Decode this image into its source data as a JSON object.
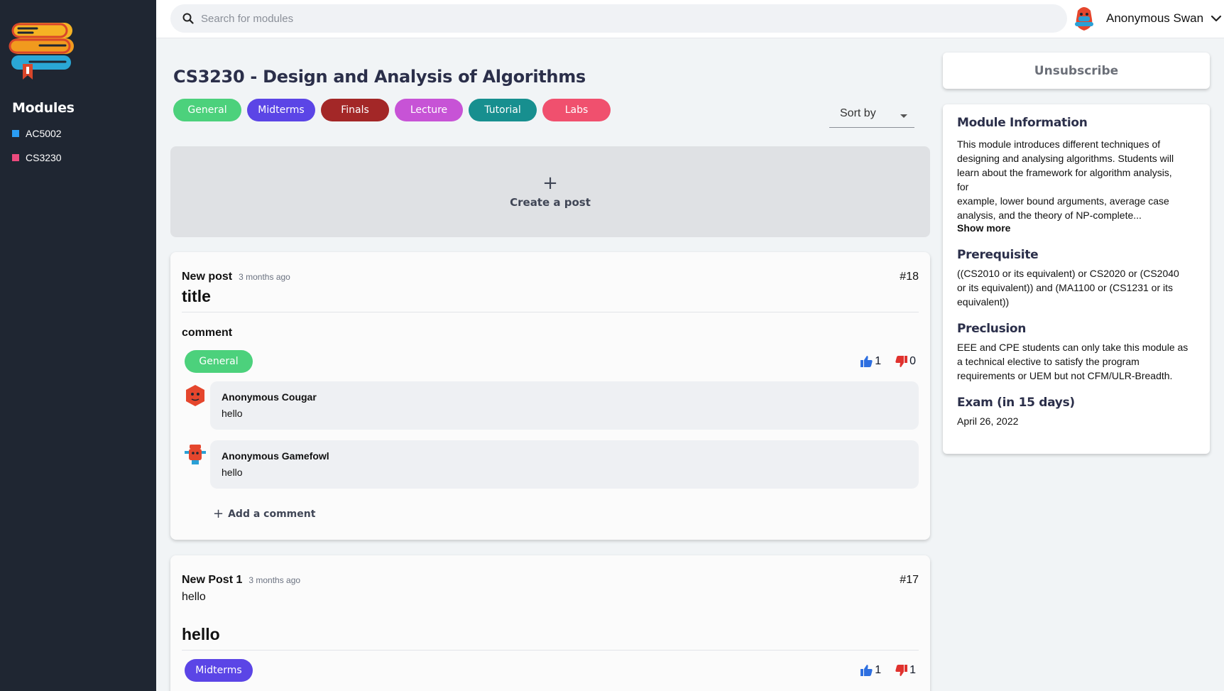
{
  "sidebar": {
    "modules_title": "Modules",
    "items": [
      {
        "label": "AC5002",
        "color": "#2a9df4"
      },
      {
        "label": "CS3230",
        "color": "#ec4a7d"
      }
    ]
  },
  "topbar": {
    "search_placeholder": "Search for modules",
    "user_name": "Anonymous Swan"
  },
  "main": {
    "title": "CS3230 - Design and Analysis of Algorithms",
    "tags": [
      {
        "label": "General",
        "color": "#4cd17c"
      },
      {
        "label": "Midterms",
        "color": "#5b45e6"
      },
      {
        "label": "Finals",
        "color": "#a32727"
      },
      {
        "label": "Lecture",
        "color": "#c753d6"
      },
      {
        "label": "Tutorial",
        "color": "#178f8f"
      },
      {
        "label": "Labs",
        "color": "#f0506e"
      }
    ],
    "sort_label": "Sort by",
    "create_post_label": "Create a post"
  },
  "posts": [
    {
      "name": "New post",
      "time": "3 months ago",
      "id": "#18",
      "title": "title",
      "body": "comment",
      "tag": "General",
      "likes": "1",
      "dislikes": "0",
      "comments": [
        {
          "author": "Anonymous Cougar",
          "text": "hello"
        },
        {
          "author": "Anonymous Gamefowl",
          "text": "hello"
        }
      ],
      "add_comment_label": "Add a comment"
    },
    {
      "name": "New Post 1",
      "time": "3 months ago",
      "id": "#17",
      "subtitle": "hello",
      "title": "hello",
      "tag": "Midterms",
      "likes": "1",
      "dislikes": "1"
    }
  ],
  "info_panel": {
    "unsubscribe_label": "Unsubscribe",
    "module_info_heading": "Module Information",
    "module_info_lines": [
      "This module introduces different techniques of",
      "designing and analysing algorithms. Students will",
      "learn about the framework for algorithm analysis,",
      "for",
      "example, lower bound arguments, average case",
      "analysis, and the theory of NP-complete..."
    ],
    "show_more": "Show more",
    "prerequisite_heading": "Prerequisite",
    "prerequisite_lines": [
      "((CS2010 or its equivalent) or CS2020 or (CS2040",
      "or its equivalent)) and (MA1100 or (CS1231 or its",
      "equivalent))"
    ],
    "preclusion_heading": "Preclusion",
    "preclusion_lines": [
      "EEE and CPE students can only take this module as",
      "a technical elective to satisfy the program",
      "requirements or UEM but not CFM/ULR-Breadth."
    ],
    "exam_heading": "Exam (in 15 days)",
    "exam_date": "April 26, 2022"
  },
  "colors": {
    "sidebar_bg": "#1f2632",
    "like_blue": "#2e6fe0",
    "dislike_red": "#e0322e"
  }
}
